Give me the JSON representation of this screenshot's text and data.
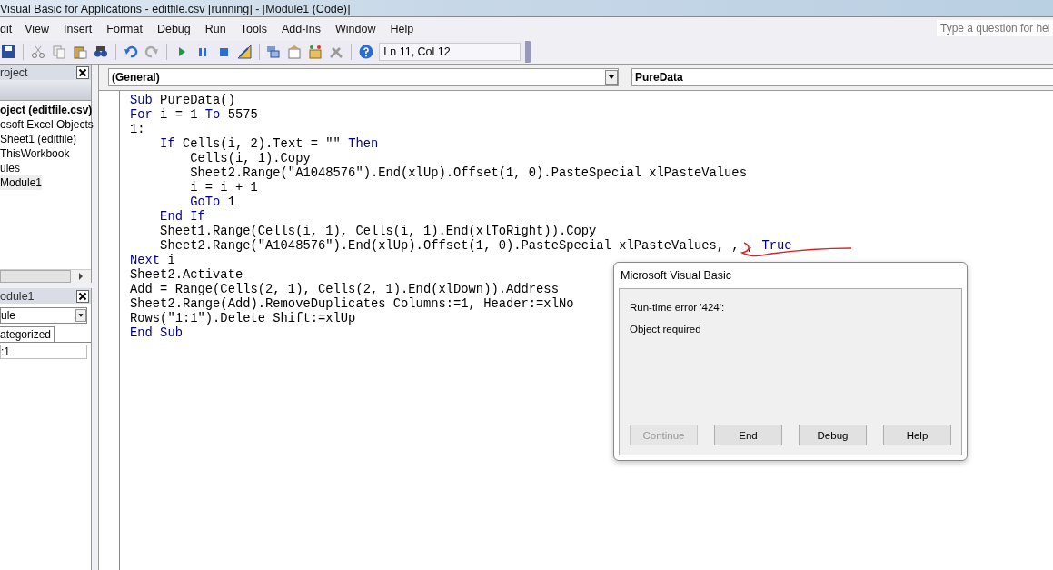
{
  "window": {
    "title": "Visual Basic for Applications - editfile.csv [running] - [Module1 (Code)]"
  },
  "menu": [
    "dit",
    "View",
    "Insert",
    "Format",
    "Debug",
    "Run",
    "Tools",
    "Add-Ins",
    "Window",
    "Help"
  ],
  "help_search": {
    "placeholder": "Type a question for hel"
  },
  "toolbar": {
    "position": "Ln 11, Col 12"
  },
  "project_pane": {
    "title": "roject",
    "tree": [
      {
        "label": "oject (editfile.csv)",
        "selected": false,
        "children": [
          {
            "label": "osoft Excel Objects",
            "selected": false,
            "children": [
              {
                "label": "Sheet1 (editfile)",
                "selected": false
              },
              {
                "label": "ThisWorkbook",
                "selected": false
              }
            ]
          },
          {
            "label": "ules",
            "selected": false,
            "children": [
              {
                "label": "Module1",
                "selected": true
              }
            ]
          }
        ]
      }
    ]
  },
  "properties_pane": {
    "title": "odule1",
    "object_combo": "ule",
    "tabs": [
      {
        "label": "ategorized",
        "selected": true
      }
    ],
    "rows": [
      ":1"
    ]
  },
  "code_window": {
    "object_combo": "(General)",
    "procedure_combo": "PureData",
    "lines": [
      [
        {
          "text": "Sub",
          "kind": "keyword"
        },
        {
          "text": " PureData()",
          "kind": "plain"
        }
      ],
      [
        {
          "text": "For",
          "kind": "keyword"
        },
        {
          "text": " i = 1 ",
          "kind": "plain"
        },
        {
          "text": "To",
          "kind": "keyword"
        },
        {
          "text": " 5575",
          "kind": "plain"
        }
      ],
      [
        {
          "text": "1:",
          "kind": "plain"
        }
      ],
      [
        {
          "text": "    If",
          "kind": "keyword"
        },
        {
          "text": " Cells(i, 2).Text = \"\" ",
          "kind": "plain"
        },
        {
          "text": "Then",
          "kind": "keyword"
        }
      ],
      [
        {
          "text": "        Cells(i, 1).Copy",
          "kind": "plain"
        }
      ],
      [
        {
          "text": "        Sheet2.Range(\"A1048576\").End(xlUp).Offset(1, 0).PasteSpecial xlPasteValues",
          "kind": "plain"
        }
      ],
      [
        {
          "text": "        i = i + 1",
          "kind": "plain"
        }
      ],
      [
        {
          "text": "        GoTo",
          "kind": "keyword"
        },
        {
          "text": " 1",
          "kind": "plain"
        }
      ],
      [
        {
          "text": "    End If",
          "kind": "keyword"
        }
      ],
      [
        {
          "text": "    Sheet1.Range(Cells(i, 1), Cells(i, 1).End(xlToRight)).Copy",
          "kind": "plain"
        }
      ],
      [
        {
          "text": "    Sheet2.Range(\"A1048576\").End(xlUp).Offset(1, 0).PasteSpecial xlPasteValues, , , ",
          "kind": "plain"
        },
        {
          "text": "True",
          "kind": "keyword"
        }
      ],
      [
        {
          "text": "Next",
          "kind": "keyword"
        },
        {
          "text": " i",
          "kind": "plain"
        }
      ],
      [
        {
          "text": "Sheet2.Activate",
          "kind": "plain"
        }
      ],
      [
        {
          "text": "Add = Range(Cells(2, 1), Cells(2, 1).End(xlDown)).Address",
          "kind": "plain"
        }
      ],
      [
        {
          "text": "Sheet2.Range(Add).RemoveDuplicates Columns:=1, Header:=xlNo",
          "kind": "plain"
        }
      ],
      [
        {
          "text": "Rows(\"1:1\").Delete Shift:=xlUp",
          "kind": "plain"
        }
      ],
      [
        {
          "text": "End Sub",
          "kind": "keyword"
        }
      ]
    ]
  },
  "dialog": {
    "title": "Microsoft Visual Basic",
    "error": "Run-time error '424':",
    "message": "Object required",
    "buttons": [
      {
        "label": "Continue",
        "disabled": true
      },
      {
        "label": "End",
        "disabled": false
      },
      {
        "label": "Debug",
        "disabled": false
      },
      {
        "label": "Help",
        "disabled": false
      }
    ]
  }
}
